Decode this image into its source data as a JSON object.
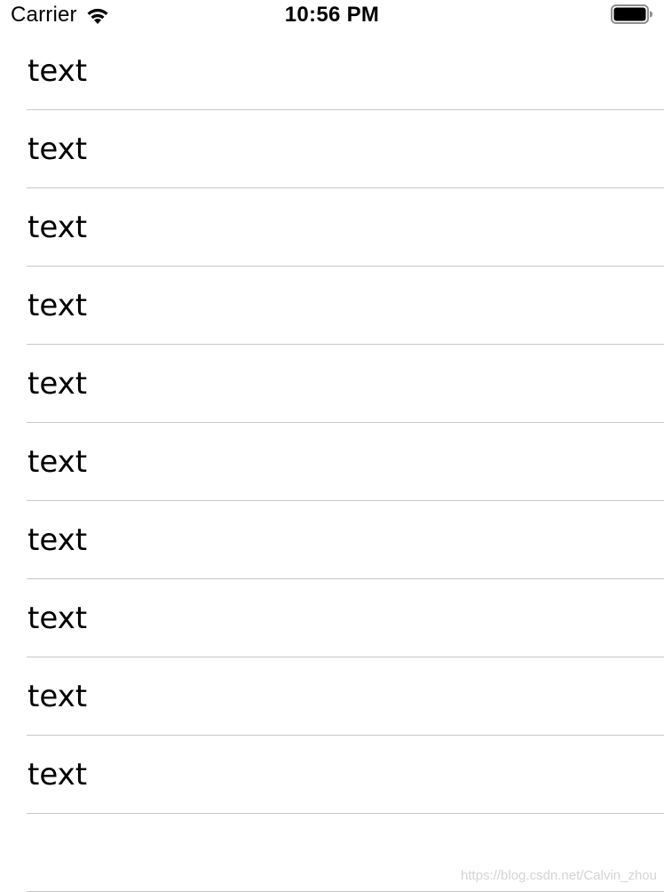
{
  "status_bar": {
    "carrier": "Carrier",
    "time": "10:56 PM",
    "wifi_icon": "wifi-icon",
    "battery_icon": "battery-icon"
  },
  "table": {
    "rows": [
      {
        "label": "text"
      },
      {
        "label": "text"
      },
      {
        "label": "text"
      },
      {
        "label": "text"
      },
      {
        "label": "text"
      },
      {
        "label": "text"
      },
      {
        "label": "text"
      },
      {
        "label": "text"
      },
      {
        "label": "text"
      },
      {
        "label": "text"
      }
    ]
  },
  "watermark": "https://blog.csdn.net/Calvin_zhou",
  "colors": {
    "separator": "#c8c7cc",
    "background": "#ffffff",
    "text": "#000000"
  }
}
